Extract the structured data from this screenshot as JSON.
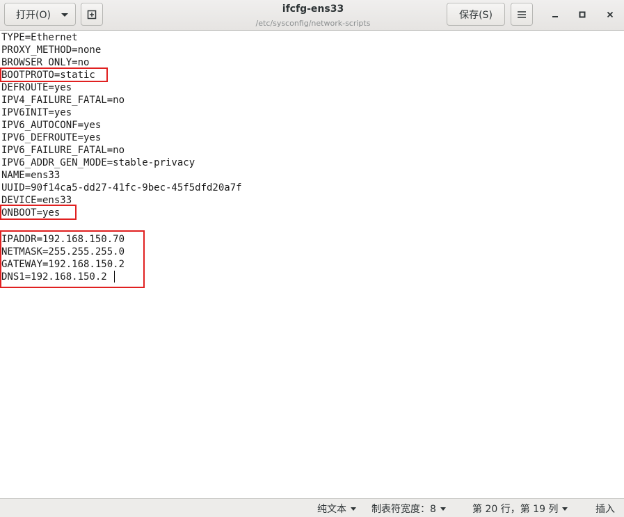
{
  "header": {
    "open_label": "打开(O)",
    "save_label": "保存(S)",
    "title": "ifcfg-ens33",
    "subtitle": "/etc/sysconfig/network-scripts"
  },
  "editor": {
    "lines": [
      "TYPE=Ethernet",
      "PROXY_METHOD=none",
      "BROWSER_ONLY=no",
      "BOOTPROTO=static",
      "DEFROUTE=yes",
      "IPV4_FAILURE_FATAL=no",
      "IPV6INIT=yes",
      "IPV6_AUTOCONF=yes",
      "IPV6_DEFROUTE=yes",
      "IPV6_FAILURE_FATAL=no",
      "IPV6_ADDR_GEN_MODE=stable-privacy",
      "NAME=ens33",
      "UUID=90f14ca5-dd27-41fc-9bec-45f5dfd20a7f",
      "DEVICE=ens33",
      "ONBOOT=yes",
      "",
      "IPADDR=192.168.150.70",
      "NETMASK=255.255.255.0",
      "GATEWAY=192.168.150.2",
      "DNS1=192.168.150.2"
    ],
    "highlight_color": "#e02020"
  },
  "statusbar": {
    "syntax_label": "纯文本",
    "tab_width_label": "制表符宽度：8",
    "position_label": "第 20 行，第 19 列",
    "insert_mode_label": "插入"
  }
}
